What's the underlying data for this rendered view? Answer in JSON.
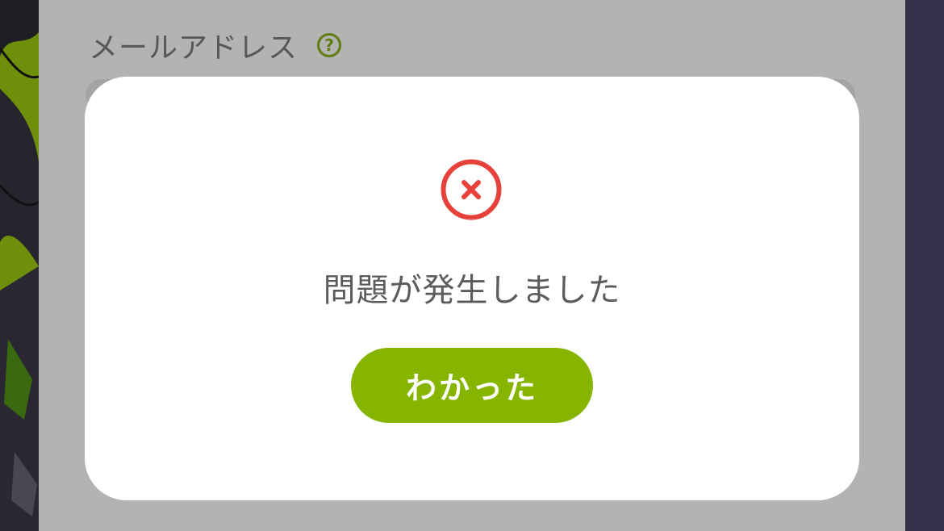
{
  "form": {
    "email_label": "メールアドレス",
    "help_icon_glyph": "?"
  },
  "dialog": {
    "icon": "error-circle-x-icon",
    "message": "問題が発生しました",
    "confirm_label": "わかった"
  },
  "colors": {
    "accent_green": "#86b500",
    "help_icon_green": "#5f7d0a",
    "error_red": "#e8403a",
    "overlay_gray": "#b3b3b3",
    "modal_background": "#ffffff"
  }
}
